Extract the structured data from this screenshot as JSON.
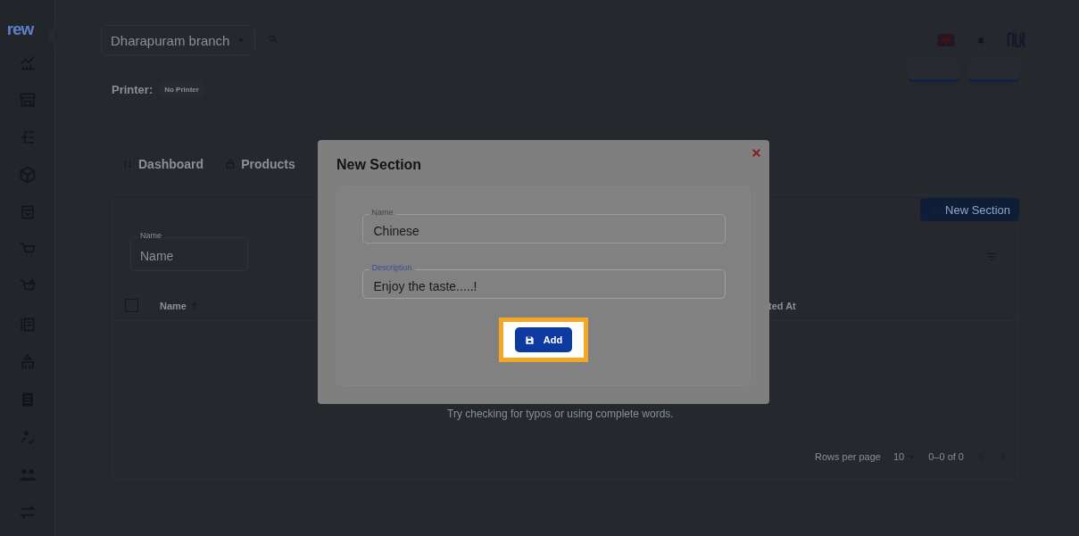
{
  "sidebar": {
    "logo": "rew"
  },
  "topbar": {
    "branch": "Dharapuram branch"
  },
  "printer": {
    "label": "Printer:",
    "value": "No Printer"
  },
  "tabs": [
    {
      "label": "Dashboard",
      "selected": false
    },
    {
      "label": "Products",
      "selected": false
    }
  ],
  "new_section_button": "New Section",
  "filter": {
    "label": "Name",
    "placeholder": "Name"
  },
  "table": {
    "columns": [
      {
        "label": "Name",
        "sorted": true
      },
      {
        "label": "ted At",
        "sorted": false
      }
    ],
    "select_all": {
      "checked": false
    },
    "empty_message": "Try checking for typos or using complete words."
  },
  "pagination": {
    "rows_label": "Rows per page",
    "rows_value": "10",
    "range": "0–0 of 0"
  },
  "dialog": {
    "title": "New Section",
    "fields": [
      {
        "label": "Name",
        "value": "Chinese",
        "focused": false
      },
      {
        "label": "Description",
        "value": "Enjoy the taste.....!",
        "focused": true
      }
    ],
    "button": {
      "label": "Add",
      "highlighted": true
    }
  }
}
